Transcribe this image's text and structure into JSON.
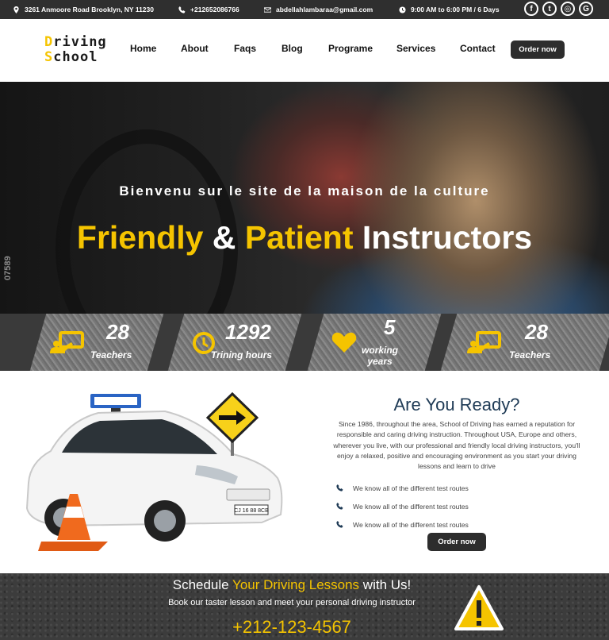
{
  "topbar": {
    "address": "3261 Anmoore Road Brooklyn, NY 11230",
    "phone": "+212652086766",
    "email": "abdellahlambaraa@gmail.com",
    "hours": "9:00 AM to 6:00 PM / 6 Days",
    "social": [
      "facebook-icon",
      "twitter-icon",
      "instagram-icon",
      "google-icon"
    ]
  },
  "logo": {
    "line1_first": "D",
    "line1_rest": "riving",
    "line2_first": "S",
    "line2_rest": "chool"
  },
  "nav": {
    "home": "Home",
    "about": "About",
    "faqs": "Faqs",
    "blog": "Blog",
    "programe": "Programe",
    "services": "Services",
    "contact": "Contact",
    "order": "Order now"
  },
  "hero": {
    "tagline": "Bienvenu sur le site de la maison de la culture",
    "headline_1": "Friendly",
    "headline_2": "&",
    "headline_3": "Patient",
    "headline_4": "Instructors",
    "watermark_number": "07589"
  },
  "stats": [
    {
      "number": "28",
      "label": "Teachers",
      "icon": "teacher-board-icon"
    },
    {
      "number": "1292",
      "label": "Trining hours",
      "icon": "clock-icon"
    },
    {
      "number": "5",
      "label": "working years",
      "icon": "heart-icon"
    },
    {
      "number": "28",
      "label": "Teachers",
      "icon": "teacher-board-icon"
    }
  ],
  "ready": {
    "title": "Are You Ready?",
    "text": "Since 1986, throughout the area, School of Driving has earned a reputation for responsible and caring driving instruction. Throughout USA, Europe and others, wherever you live, with our professional and friendly local driving instructors, you'll enjoy a relaxed, positive and encouraging environment as you start your driving lessons and learn to drive",
    "items": [
      "We know all of the different test routes",
      "We know all of the different test routes",
      "We know all of the different test routes"
    ],
    "order": "Order now",
    "car_plate": "CJ 16 88 8CB"
  },
  "schedule": {
    "title_1": "Schedule",
    "title_2": "Your Driving Lessons",
    "title_3": "with Us!",
    "subtitle": "Book our taster lesson and meet your personal driving instructor",
    "phone": "+212-123-4567"
  },
  "colors": {
    "accent": "#f5c400",
    "dark": "#2d2d2d",
    "title_blue": "#1e3a55"
  }
}
